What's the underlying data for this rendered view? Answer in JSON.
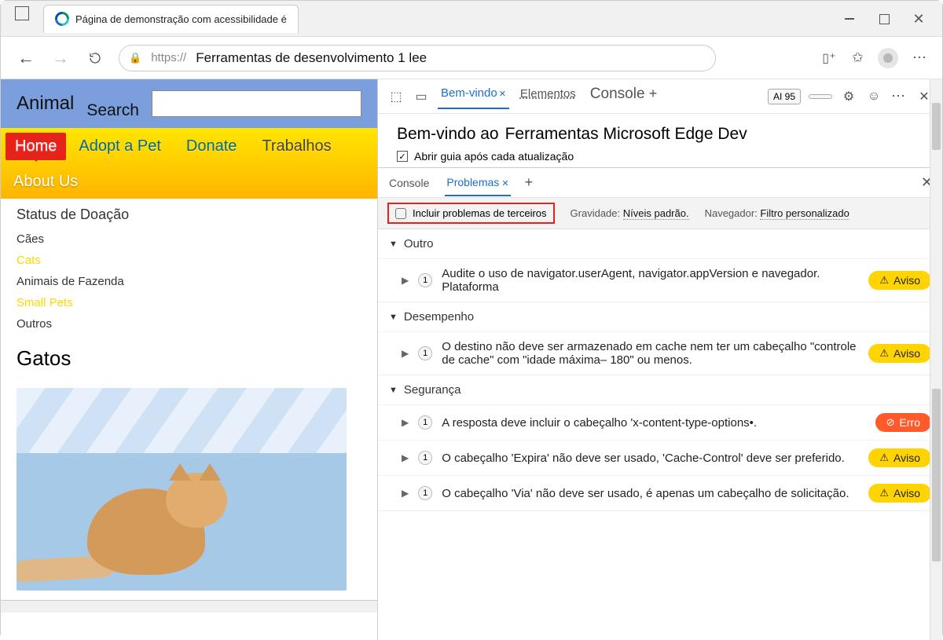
{
  "window": {
    "tab_title": "Página de demonstração com acessibilidade é"
  },
  "toolbar": {
    "scheme": "https://",
    "url": "Ferramentas de desenvolvimento 1 lee"
  },
  "page": {
    "brand": "Animal",
    "search_label": "Search",
    "nav": {
      "home": "Home",
      "adopt": "Adopt a Pet",
      "donate": "Donate",
      "jobs": "Trabalhos",
      "about": "About Us"
    },
    "status": "Status de Doação",
    "list": {
      "dogs": "Cães",
      "cats": "Cats",
      "farm": "Animais de Fazenda",
      "small": "Small Pets",
      "other": "Outros"
    },
    "heading": "Gatos"
  },
  "devtools": {
    "tabs": {
      "welcome": "Bem-vindo",
      "elements": "Elementos",
      "console": "Console"
    },
    "badge": "AI 95",
    "welcome": {
      "prefix": "Bem-vindo ao",
      "title": "Ferramentas Microsoft Edge Dev",
      "checkbox": "Abrir guia após cada atualização"
    },
    "drawer": {
      "console": "Console",
      "issues": "Problemas"
    },
    "filters": {
      "third_party": "Incluir problemas de terceiros",
      "severity_label": "Gravidade:",
      "severity_value": "Níveis padrão.",
      "browser_label": "Navegador:",
      "browser_value": "Filtro personalizado"
    },
    "groups": {
      "other": "Outro",
      "perf": "Desempenho",
      "security": "Segurança"
    },
    "severity": {
      "warn": "Aviso",
      "error": "Erro"
    },
    "issues": {
      "ua": "Audite o uso de navigator.userAgent, navigator.appVersion e navegador. Plataforma",
      "cache": "O destino não deve ser armazenado em cache nem ter um cabeçalho \"controle de cache\" com \"idade máxima– 180\" ou menos.",
      "xcto": "A resposta deve incluir o cabeçalho 'x-content-type-options•.",
      "expires": "O cabeçalho 'Expira' não deve ser usado, 'Cache-Control' deve ser preferido.",
      "via": "O cabeçalho 'Via' não deve ser usado, é apenas um cabeçalho de solicitação."
    },
    "count_one": "1"
  }
}
